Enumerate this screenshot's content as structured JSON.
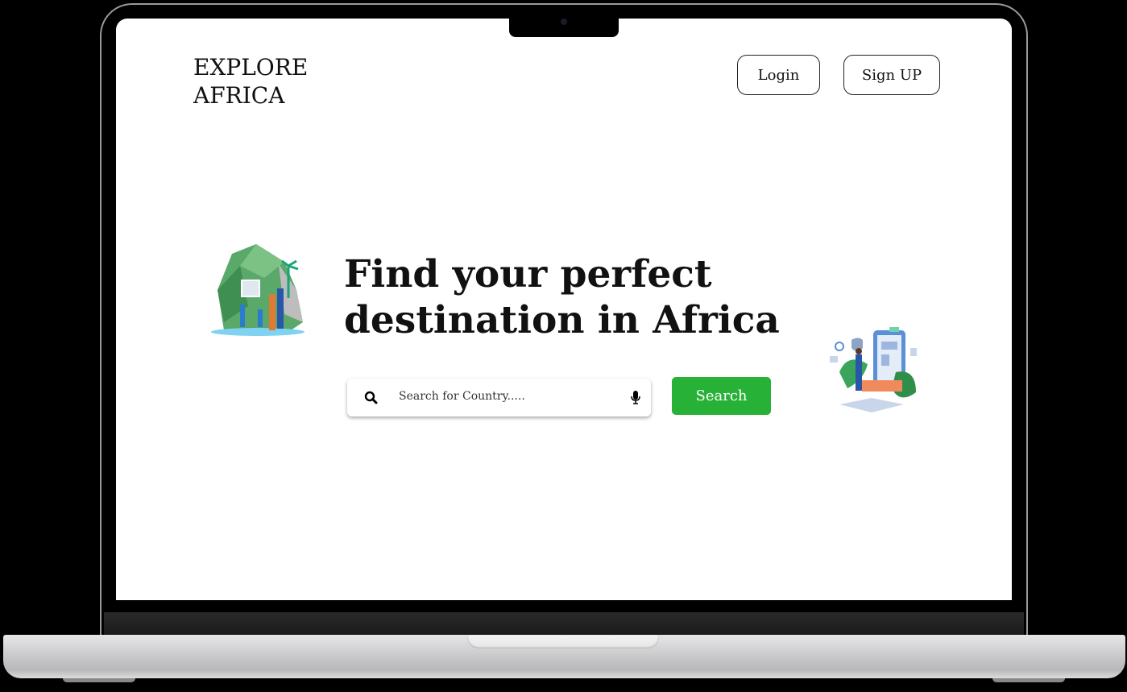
{
  "header": {
    "logo_line1": "EXPLORE",
    "logo_line2": "AFRICA",
    "login_label": "Login",
    "signup_label": "Sign UP"
  },
  "hero": {
    "headline_line1": "Find your perfect",
    "headline_line2": "destination in Africa"
  },
  "search": {
    "placeholder": "Search for Country.....",
    "value": "",
    "button_label": "Search"
  },
  "colors": {
    "accent": "#28b137"
  }
}
